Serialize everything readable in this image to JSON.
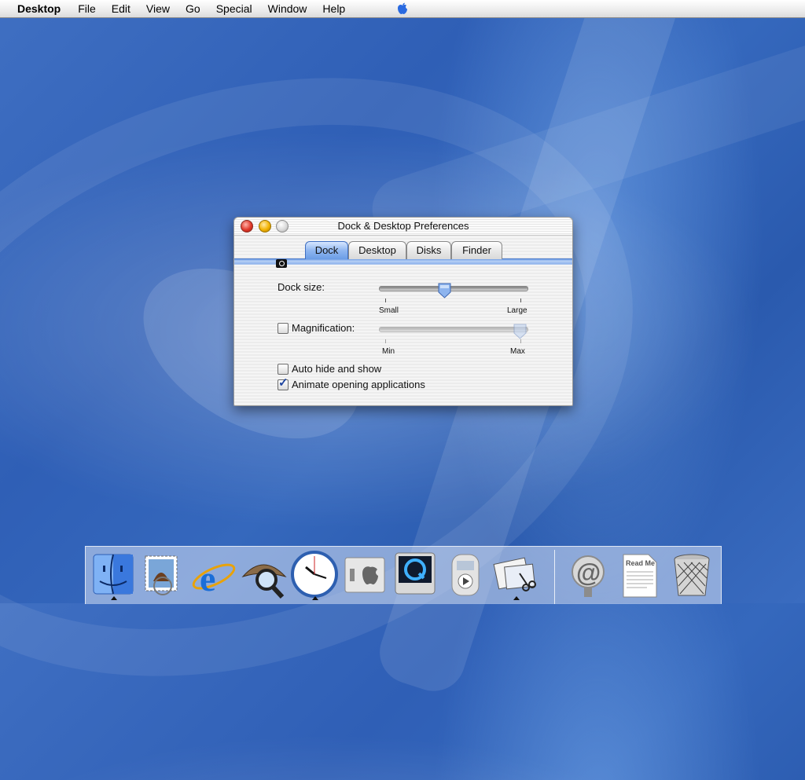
{
  "menubar": {
    "app_name": "Desktop",
    "items": [
      "File",
      "Edit",
      "View",
      "Go",
      "Special",
      "Window",
      "Help"
    ],
    "apple_icon": "apple-logo-icon"
  },
  "window": {
    "title": "Dock & Desktop Preferences",
    "tabs": [
      {
        "label": "Dock",
        "active": true
      },
      {
        "label": "Desktop",
        "active": false
      },
      {
        "label": "Disks",
        "active": false
      },
      {
        "label": "Finder",
        "active": false
      }
    ],
    "dock_size": {
      "label": "Dock size:",
      "min_label": "Small",
      "max_label": "Large",
      "value": 0.44
    },
    "magnification": {
      "label": "Magnification:",
      "checked": false,
      "min_label": "Min",
      "max_label": "Max",
      "value": 1.0
    },
    "auto_hide": {
      "label": "Auto hide and show",
      "checked": false
    },
    "animate": {
      "label": "Animate opening applications",
      "checked": true
    }
  },
  "dock": {
    "items": [
      {
        "name": "finder",
        "icon": "finder-face-icon",
        "running": true
      },
      {
        "name": "mail",
        "icon": "mail-stamp-icon",
        "running": false
      },
      {
        "name": "internet-explorer",
        "icon": "internet-explorer-icon",
        "running": false
      },
      {
        "name": "sherlock",
        "icon": "sherlock-hat-magnifier-icon",
        "running": false
      },
      {
        "name": "clock",
        "icon": "clock-icon",
        "running": true
      },
      {
        "name": "system-preferences",
        "icon": "light-switch-apple-icon",
        "running": false
      },
      {
        "name": "quicktime",
        "icon": "quicktime-icon",
        "running": false
      },
      {
        "name": "itunes-player",
        "icon": "media-player-icon",
        "running": false
      },
      {
        "name": "preferences-app",
        "icon": "windows-scissors-icon",
        "running": true
      },
      {
        "name": "mail-link",
        "icon": "at-sign-icon",
        "running": false
      },
      {
        "name": "read-me",
        "icon": "document-icon",
        "running": false,
        "text": "Read Me"
      },
      {
        "name": "trash",
        "icon": "trash-can-icon",
        "running": false
      }
    ]
  },
  "colors": {
    "desktop": "#3466ba",
    "tab_active": "#6b9de6",
    "check": "#1f45a0"
  }
}
